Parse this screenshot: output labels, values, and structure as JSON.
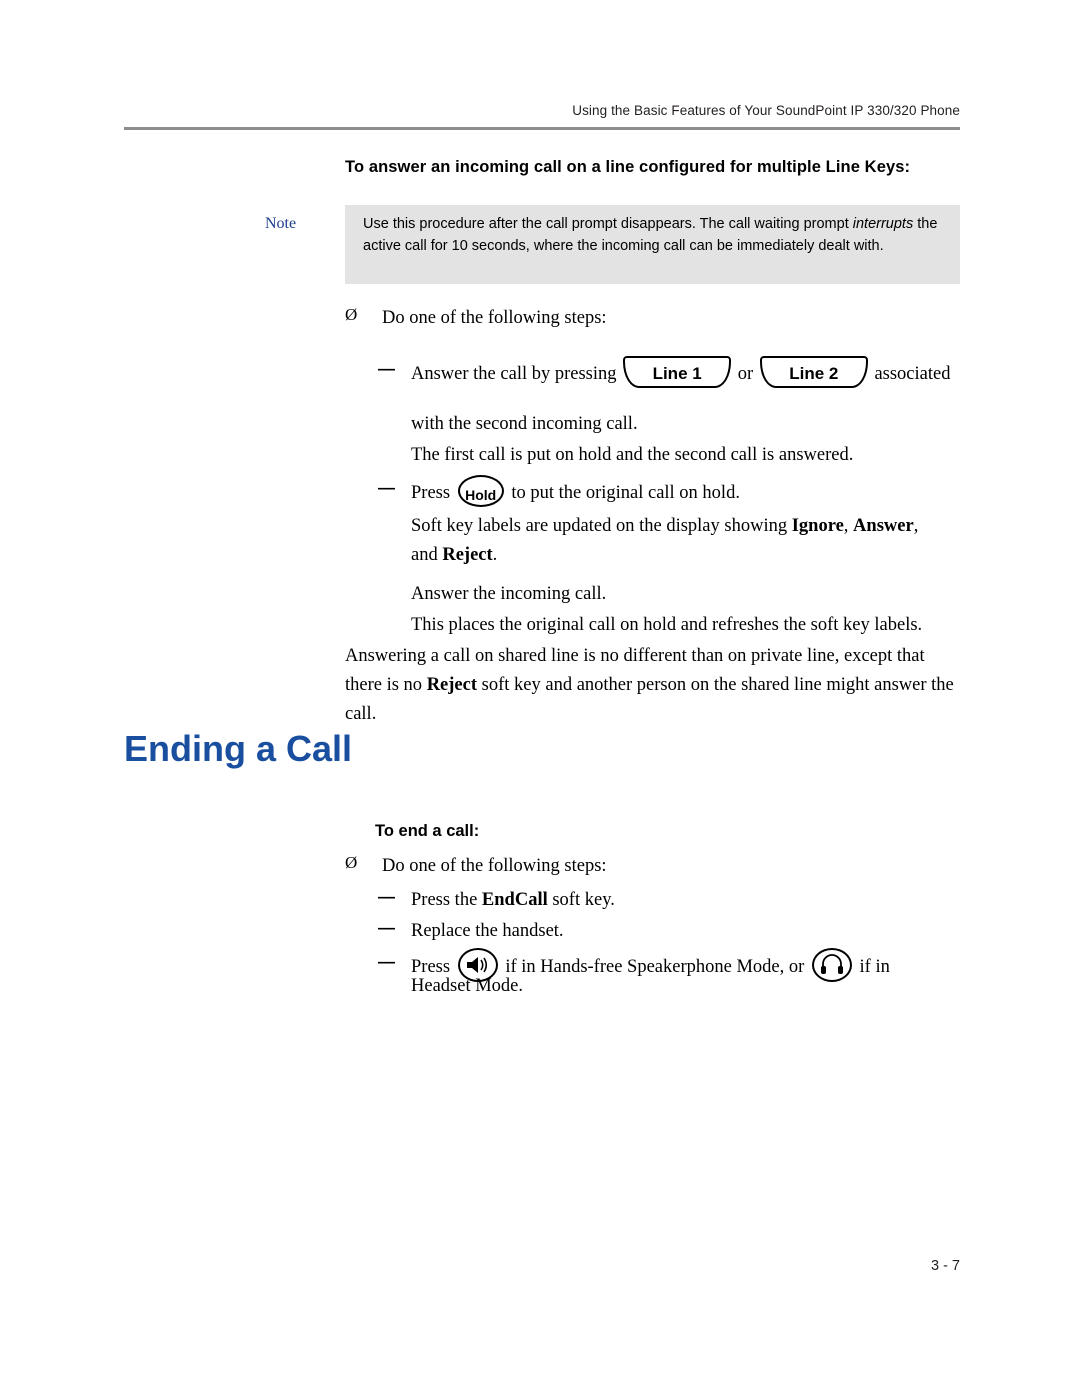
{
  "header": {
    "running_head": "Using the Basic Features of Your SoundPoint IP 330/320 Phone"
  },
  "section1": {
    "heading": "To answer an incoming call on a line configured for multiple Line Keys:",
    "note_label": "Note",
    "note_text_part1": "Use this procedure after the call prompt disappears. The call waiting prompt ",
    "note_text_italic": "interrupts",
    "note_text_part2": " the active call for 10 seconds, where the incoming call can be immediately dealt with.",
    "bullet_arrow": "Ø",
    "dash": "—",
    "step_intro": "Do one of the following steps:",
    "step1_pre": "Answer the call by pressing",
    "step1_or": "or",
    "step1_post": "associated",
    "step1_line2": "with the second incoming call.",
    "step1_result": "The first call is put on hold and the second call is answered.",
    "line_key_1": "Line 1",
    "line_key_2": "Line 2",
    "hold_key": "Hold",
    "step2_pre": "Press",
    "step2_post": "to put the original call on hold.",
    "step2_result_a": "Soft key labels are updated on the display showing ",
    "step2_result_ignore": "Ignore",
    "step2_result_comma": ", ",
    "step2_result_answer": "Answer",
    "step2_result_b": ",",
    "step2_result_c": "and ",
    "step2_result_reject": "Reject",
    "step2_result_d": ".",
    "step2_answer_line": "Answer the incoming call.",
    "step2_places_line": "This places the original call on hold and refreshes the soft key labels.",
    "paragraph_a": "Answering a call on shared line is no different than on private line, except that there is no ",
    "paragraph_reject": "Reject",
    "paragraph_b": " soft key and another person on the shared line might answer the call."
  },
  "section2": {
    "title": "Ending a Call",
    "heading": "To end a call:",
    "step_intro": "Do one of the following steps:",
    "item1_pre": "Press the ",
    "item1_bold": "EndCall",
    "item1_post": " soft key.",
    "item2": "Replace the handset.",
    "item3_pre": "Press",
    "item3_mid": "if in Hands-free Speakerphone Mode, or",
    "item3_post": "if in",
    "item3_line2": "Headset Mode."
  },
  "footer": {
    "page_number": "3 - 7"
  },
  "colors": {
    "heading_blue": "#1a4fa0",
    "note_label_blue": "#1a3e8c",
    "note_background": "#e3e3e3",
    "rule_gray": "#8d8d8d"
  }
}
